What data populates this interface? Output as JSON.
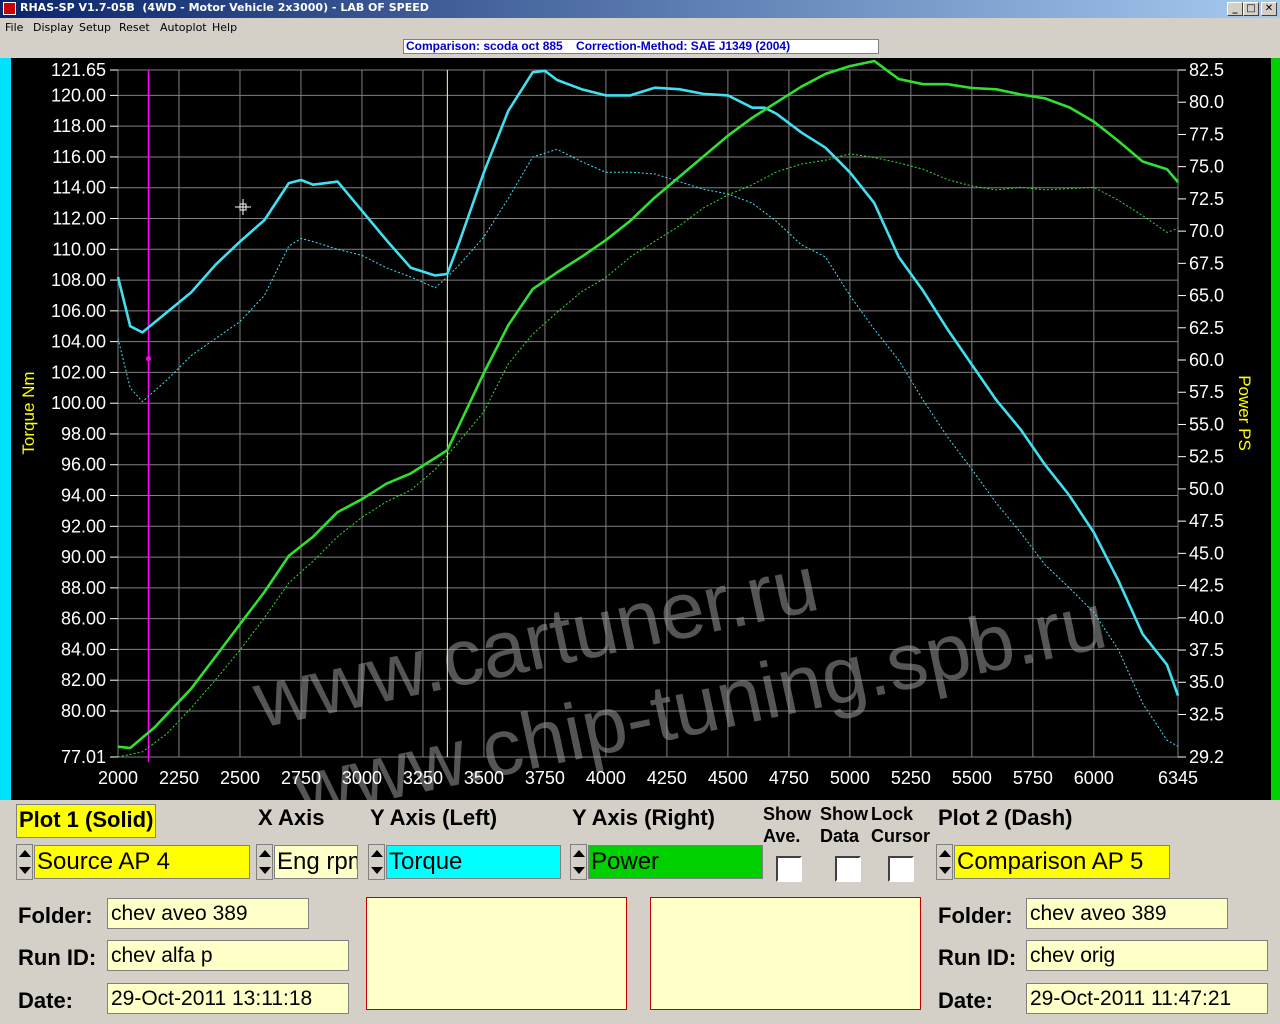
{
  "window": {
    "title": "RHAS-SP V1.7-05B  (4WD - Motor Vehicle 2x3000) - LAB OF SPEED",
    "btn_min": "_",
    "btn_max": "□",
    "btn_close": "✕"
  },
  "menu": [
    "File",
    "Display",
    "Setup",
    "Reset",
    "Autoplot",
    "Help"
  ],
  "header": {
    "info": "Comparison: scoda oct 885    Correction-Method: SAE J1349 (2004)"
  },
  "watermark": {
    "line1": "www.cartuner.ru",
    "line2": "www.chip-tuning.spb.ru"
  },
  "chart_data": {
    "type": "line",
    "ylabel": "Torque Nm",
    "y2label": "Power PS",
    "x_ticks": [
      "2000",
      "2250",
      "2500",
      "2750",
      "3000",
      "3250",
      "3500",
      "3750",
      "4000",
      "4250",
      "4500",
      "4750",
      "5000",
      "5250",
      "5500",
      "5750",
      "6000",
      "6345"
    ],
    "y_ticks": [
      "121.65",
      "120.00",
      "118.00",
      "116.00",
      "114.00",
      "112.00",
      "110.00",
      "108.00",
      "106.00",
      "104.00",
      "102.00",
      "100.00",
      "98.00",
      "96.00",
      "94.00",
      "92.00",
      "90.00",
      "88.00",
      "86.00",
      "84.00",
      "82.00",
      "80.00",
      "77.01"
    ],
    "y2_ticks": [
      "82.5",
      "80.0",
      "77.5",
      "75.0",
      "72.5",
      "70.0",
      "67.5",
      "65.0",
      "62.5",
      "60.0",
      "57.5",
      "55.0",
      "52.5",
      "50.0",
      "47.5",
      "45.0",
      "42.5",
      "40.0",
      "37.5",
      "35.0",
      "32.5",
      "29.2"
    ],
    "xlim": [
      2000,
      6345
    ],
    "ylim": [
      77.01,
      121.65
    ],
    "y2lim": [
      29.2,
      82.5
    ],
    "cursors": {
      "left_x": 2125,
      "right_x": 3350
    },
    "colors": {
      "torque": "#40e0f0",
      "power": "#30e030",
      "grid": "#808080",
      "axis_text": "#ffffff",
      "label_text": "#ffff00",
      "cursor1": "#ff00ff",
      "cursor2": "#ffffb0"
    },
    "series": [
      {
        "name": "Torque",
        "axis": "left",
        "style": "solid",
        "points": [
          [
            2000,
            108.2
          ],
          [
            2050,
            105
          ],
          [
            2100,
            104.6
          ],
          [
            2200,
            105.9
          ],
          [
            2300,
            107.2
          ],
          [
            2400,
            109
          ],
          [
            2500,
            110.5
          ],
          [
            2600,
            111.9
          ],
          [
            2700,
            114.3
          ],
          [
            2750,
            114.5
          ],
          [
            2800,
            114.2
          ],
          [
            2900,
            114.4
          ],
          [
            3000,
            112.5
          ],
          [
            3100,
            110.6
          ],
          [
            3200,
            108.8
          ],
          [
            3300,
            108.3
          ],
          [
            3350,
            108.4
          ],
          [
            3400,
            110.5
          ],
          [
            3500,
            115
          ],
          [
            3600,
            119
          ],
          [
            3700,
            121.5
          ],
          [
            3750,
            121.6
          ],
          [
            3800,
            121
          ],
          [
            3900,
            120.4
          ],
          [
            4000,
            120
          ],
          [
            4100,
            120
          ],
          [
            4200,
            120.5
          ],
          [
            4300,
            120.4
          ],
          [
            4400,
            120.1
          ],
          [
            4500,
            120
          ],
          [
            4600,
            119.2
          ],
          [
            4650,
            119.2
          ],
          [
            4700,
            118.8
          ],
          [
            4800,
            117.6
          ],
          [
            4900,
            116.6
          ],
          [
            5000,
            115
          ],
          [
            5100,
            113
          ],
          [
            5200,
            109.5
          ],
          [
            5300,
            107.3
          ],
          [
            5400,
            104.8
          ],
          [
            5500,
            102.5
          ],
          [
            5600,
            100.2
          ],
          [
            5700,
            98.3
          ],
          [
            5800,
            96
          ],
          [
            5900,
            94
          ],
          [
            6000,
            91.6
          ],
          [
            6100,
            88.5
          ],
          [
            6200,
            85
          ],
          [
            6300,
            83
          ],
          [
            6345,
            81
          ]
        ]
      },
      {
        "name": "Power",
        "axis": "right",
        "style": "solid",
        "points": [
          [
            2000,
            30
          ],
          [
            2050,
            29.9
          ],
          [
            2150,
            31.5
          ],
          [
            2300,
            34.5
          ],
          [
            2400,
            37
          ],
          [
            2500,
            39.5
          ],
          [
            2600,
            42
          ],
          [
            2700,
            44.8
          ],
          [
            2800,
            46.3
          ],
          [
            2900,
            48.2
          ],
          [
            3000,
            49.2
          ],
          [
            3100,
            50.4
          ],
          [
            3200,
            51.2
          ],
          [
            3300,
            52.4
          ],
          [
            3350,
            53
          ],
          [
            3400,
            55
          ],
          [
            3500,
            59
          ],
          [
            3600,
            62.7
          ],
          [
            3700,
            65.5
          ],
          [
            3800,
            66.8
          ],
          [
            3900,
            68
          ],
          [
            4000,
            69.3
          ],
          [
            4100,
            70.8
          ],
          [
            4200,
            72.6
          ],
          [
            4300,
            74.2
          ],
          [
            4400,
            75.8
          ],
          [
            4500,
            77.4
          ],
          [
            4600,
            78.8
          ],
          [
            4700,
            80
          ],
          [
            4800,
            81.2
          ],
          [
            4900,
            82.2
          ],
          [
            5000,
            82.8
          ],
          [
            5100,
            83.2
          ],
          [
            5200,
            81.8
          ],
          [
            5300,
            81.4
          ],
          [
            5400,
            81.4
          ],
          [
            5500,
            81.1
          ],
          [
            5600,
            81
          ],
          [
            5700,
            80.6
          ],
          [
            5800,
            80.3
          ],
          [
            5900,
            79.6
          ],
          [
            6000,
            78.5
          ],
          [
            6100,
            77
          ],
          [
            6200,
            75.4
          ],
          [
            6300,
            74.8
          ],
          [
            6345,
            73.8
          ]
        ]
      },
      {
        "name": "Torque (comparison)",
        "axis": "left",
        "style": "dash",
        "points": [
          [
            2000,
            104.2
          ],
          [
            2050,
            101
          ],
          [
            2100,
            100.1
          ],
          [
            2200,
            101.5
          ],
          [
            2300,
            103.1
          ],
          [
            2400,
            104.2
          ],
          [
            2500,
            105.3
          ],
          [
            2600,
            107
          ],
          [
            2700,
            110.2
          ],
          [
            2750,
            110.7
          ],
          [
            2800,
            110.5
          ],
          [
            2900,
            110
          ],
          [
            3000,
            109.6
          ],
          [
            3100,
            108.8
          ],
          [
            3200,
            108.2
          ],
          [
            3300,
            107.5
          ],
          [
            3350,
            108.2
          ],
          [
            3400,
            109
          ],
          [
            3500,
            110.8
          ],
          [
            3600,
            113.3
          ],
          [
            3700,
            116
          ],
          [
            3800,
            116.5
          ],
          [
            3900,
            115.7
          ],
          [
            4000,
            115
          ],
          [
            4100,
            115
          ],
          [
            4200,
            114.9
          ],
          [
            4300,
            114.4
          ],
          [
            4400,
            113.9
          ],
          [
            4500,
            113.6
          ],
          [
            4600,
            113
          ],
          [
            4700,
            111.8
          ],
          [
            4800,
            110.3
          ],
          [
            4900,
            109.5
          ],
          [
            5000,
            107
          ],
          [
            5100,
            104.8
          ],
          [
            5200,
            102.8
          ],
          [
            5300,
            100.2
          ],
          [
            5400,
            97.8
          ],
          [
            5500,
            95.7
          ],
          [
            5600,
            93.5
          ],
          [
            5700,
            91.6
          ],
          [
            5800,
            89.5
          ],
          [
            5900,
            88
          ],
          [
            6000,
            86.4
          ],
          [
            6100,
            84
          ],
          [
            6200,
            80.5
          ],
          [
            6300,
            78.1
          ],
          [
            6345,
            77.7
          ]
        ]
      },
      {
        "name": "Power (comparison)",
        "axis": "right",
        "style": "dash",
        "points": [
          [
            2000,
            29.2
          ],
          [
            2100,
            29.6
          ],
          [
            2200,
            31
          ],
          [
            2300,
            33
          ],
          [
            2400,
            35.2
          ],
          [
            2500,
            37.5
          ],
          [
            2600,
            40
          ],
          [
            2700,
            42.7
          ],
          [
            2800,
            44.4
          ],
          [
            2900,
            46.3
          ],
          [
            3000,
            47.8
          ],
          [
            3100,
            49
          ],
          [
            3200,
            49.9
          ],
          [
            3300,
            51.5
          ],
          [
            3400,
            53.7
          ],
          [
            3500,
            56
          ],
          [
            3600,
            59.7
          ],
          [
            3700,
            62
          ],
          [
            3800,
            63.7
          ],
          [
            3900,
            65.3
          ],
          [
            4000,
            66.4
          ],
          [
            4100,
            68
          ],
          [
            4200,
            69.2
          ],
          [
            4300,
            70.4
          ],
          [
            4400,
            71.8
          ],
          [
            4500,
            72.8
          ],
          [
            4600,
            73.6
          ],
          [
            4700,
            74.6
          ],
          [
            4800,
            75.2
          ],
          [
            4900,
            75.5
          ],
          [
            5000,
            76
          ],
          [
            5100,
            75.7
          ],
          [
            5200,
            75.3
          ],
          [
            5300,
            74.8
          ],
          [
            5400,
            74
          ],
          [
            5500,
            73.5
          ],
          [
            5600,
            73.2
          ],
          [
            5700,
            73.4
          ],
          [
            5800,
            73.2
          ],
          [
            5900,
            73.3
          ],
          [
            6000,
            73.4
          ],
          [
            6100,
            72.4
          ],
          [
            6200,
            71.2
          ],
          [
            6300,
            69.9
          ],
          [
            6345,
            70.2
          ]
        ]
      }
    ]
  },
  "controls": {
    "plot1_label": "Plot 1 (Solid)",
    "xaxis_label": "X Axis",
    "yleft_label": "Y Axis (Left)",
    "yright_label": "Y Axis (Right)",
    "show_ave_label": "Show\nAve.",
    "show_data_label": "Show\nData",
    "lock_cursor_label": "Lock\nCursor",
    "plot2_label": "Plot 2 (Dash)",
    "plot1_source": "Source AP 4",
    "xaxis_value": "Eng rpm",
    "yleft_value": "Torque",
    "yright_value": "Power",
    "plot2_source": "Comparison AP 5",
    "colors": {
      "yellow": "#ffff00",
      "cyan": "#00ffff",
      "green": "#00d000"
    }
  },
  "info": {
    "folder_label": "Folder:",
    "runid_label": "Run ID:",
    "date_label": "Date:",
    "left": {
      "folder": "chev aveo 389",
      "runid": "chev alfa p",
      "date": "29-Oct-2011  13:11:18"
    },
    "right": {
      "folder": "chev aveo 389",
      "runid": "chev orig",
      "date": "29-Oct-2011  11:47:21"
    }
  }
}
